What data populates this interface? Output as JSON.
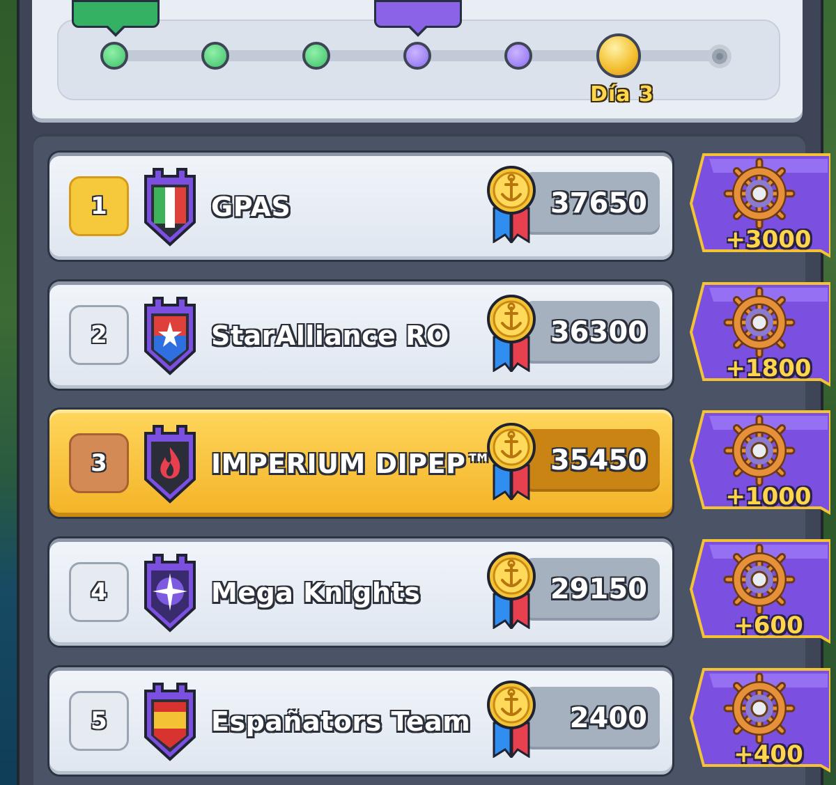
{
  "progress": {
    "day_label": "Día 3",
    "nodes": [
      "green",
      "green",
      "green",
      "purple",
      "purple",
      "current",
      "locked"
    ]
  },
  "colors": {
    "accent_gold": "#f4c235",
    "row_default": "#e6ebf2",
    "row_highlight": "#f3b327",
    "reward_purple": "#7b4fe0"
  },
  "leaderboard": [
    {
      "rank": "1",
      "name": "GPAS",
      "score": "37650",
      "reward": "+3000",
      "badge": "gold",
      "shield": "italy-flag"
    },
    {
      "rank": "2",
      "name": "StarAlliance RO",
      "score": "36300",
      "reward": "+1800",
      "badge": "silver",
      "shield": "star-flag"
    },
    {
      "rank": "3",
      "name": "IMPERIUM DIPEP™",
      "score": "35450",
      "reward": "+1000",
      "badge": "bronze",
      "shield": "fire",
      "highlight": true
    },
    {
      "rank": "4",
      "name": "Mega Knights",
      "score": "29150",
      "reward": "+600",
      "badge": "silver",
      "shield": "sparkle"
    },
    {
      "rank": "5",
      "name": "Españators Team",
      "score": "2400",
      "reward": "+400",
      "badge": "silver",
      "shield": "spain-flag"
    }
  ],
  "icons": {
    "medal": "anchor-medal-icon",
    "reward": "ship-wheel-icon"
  }
}
